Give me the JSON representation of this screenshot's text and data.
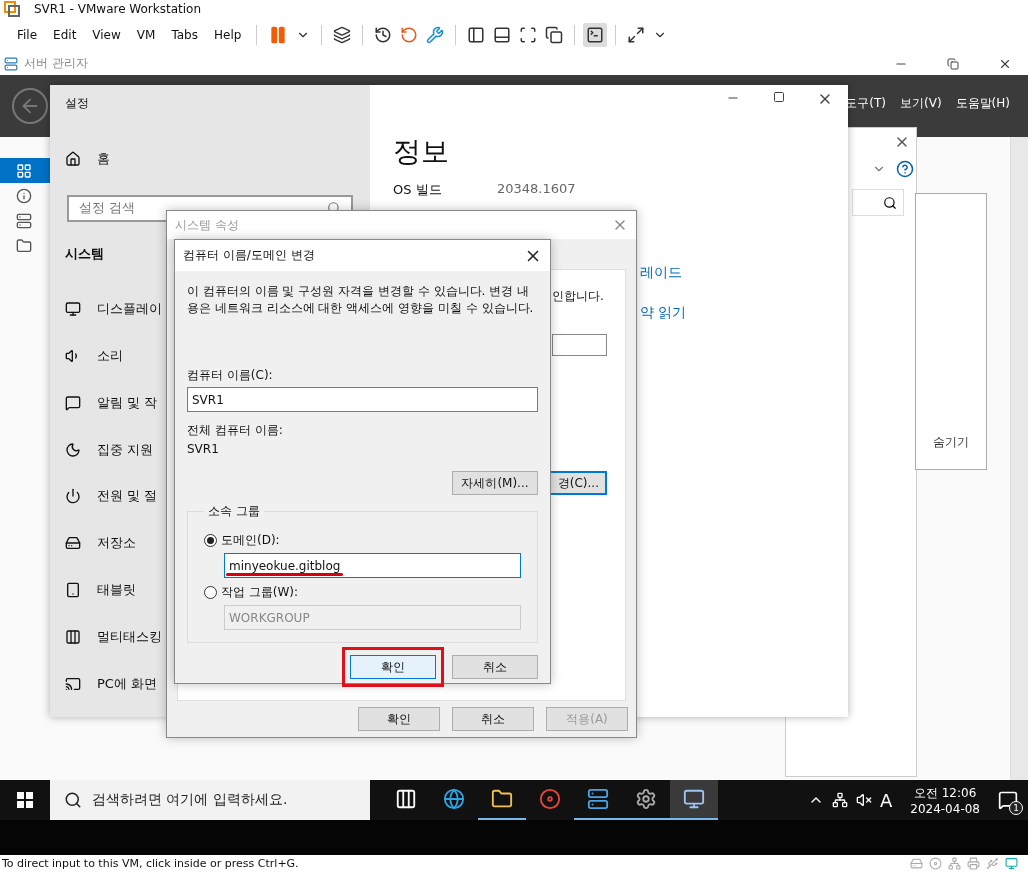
{
  "vmware": {
    "title": "SVR1 - VMware Workstation",
    "menu": [
      "File",
      "Edit",
      "View",
      "VM",
      "Tabs",
      "Help"
    ],
    "status": "To direct input to this VM, click inside or press Ctrl+G."
  },
  "guest_window": {
    "title": "서버 관리자"
  },
  "server_manager": {
    "menu": [
      "도구(T)",
      "보기(V)",
      "도움말(H)"
    ],
    "nav": [
      {
        "selected": true
      },
      {
        "selected": false
      },
      {
        "selected": false
      },
      {
        "selected": false
      }
    ],
    "side_button": "숨기기"
  },
  "settings": {
    "title": "설정",
    "home": "홈",
    "search_placeholder": "설정 검색",
    "section": "시스템",
    "nav": [
      {
        "label": "디스플레이"
      },
      {
        "label": "소리"
      },
      {
        "label": "알림 및 작"
      },
      {
        "label": "집중 지원"
      },
      {
        "label": "전원 및 절"
      },
      {
        "label": "저장소"
      },
      {
        "label": "태블릿"
      },
      {
        "label": "멀티태스킹"
      },
      {
        "label": "PC에 화면"
      }
    ],
    "heading": "정보",
    "specs": [
      {
        "label": "OS 빌드",
        "value": "20348.1607"
      }
    ],
    "links": [
      "레이드",
      "약 읽기"
    ]
  },
  "system_properties": {
    "title": "시스템 속성",
    "behind_text": "인합니다.",
    "behind_button": "경(C)...",
    "buttons": [
      {
        "label": "확인",
        "disabled": false
      },
      {
        "label": "취소",
        "disabled": false
      },
      {
        "label": "적용(A)",
        "disabled": true
      }
    ]
  },
  "name_dialog": {
    "title": "컴퓨터 이름/도메인 변경",
    "description": "이 컴퓨터의 이름 및 구성원 자격을 변경할 수 있습니다. 변경 내용은 네트워크 리소스에 대한 액세스에 영향을 미칠 수 있습니다.",
    "name_label": "컴퓨터 이름(C):",
    "name_value": "SVR1",
    "full_label": "전체 컴퓨터 이름:",
    "full_value": "SVR1",
    "more_button": "자세히(M)...",
    "group_title": "소속 그룹",
    "members": [
      {
        "label": "도메인(D):",
        "selected": true,
        "value": "minyeokue.gitblog",
        "underlined": true
      },
      {
        "label": "작업 그룹(W):",
        "selected": false,
        "value": "WORKGROUP",
        "underlined": false
      }
    ],
    "buttons": [
      {
        "label": "확인",
        "highlighted": true
      },
      {
        "label": "취소",
        "highlighted": false
      }
    ]
  },
  "taskbar": {
    "search_placeholder": "검색하려면 여기에 입력하세요.",
    "apps": [
      {
        "running": false,
        "selected": false
      },
      {
        "running": false,
        "selected": false
      },
      {
        "running": true,
        "selected": false
      },
      {
        "running": false,
        "selected": false
      },
      {
        "running": true,
        "selected": false
      },
      {
        "running": true,
        "selected": false
      },
      {
        "running": true,
        "selected": true
      }
    ],
    "ime": "A",
    "time": "오전 12:06",
    "date": "2024-04-08",
    "notifications": "1"
  }
}
